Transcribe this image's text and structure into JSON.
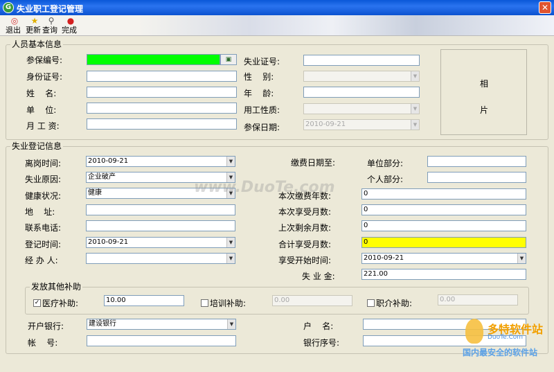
{
  "window": {
    "title": "失业职工登记管理",
    "close_glyph": "✕"
  },
  "toolbar": {
    "exit_label": "退出",
    "update_label": "更新",
    "query_label": "查询",
    "done_label": "完成"
  },
  "basic": {
    "group_title": "人员基本信息",
    "insurance_no_label": "参保编号:",
    "id_no_label": "身份证号:",
    "name_label": "姓    名:",
    "unit_label": "单    位:",
    "salary_label": "月 工 资:",
    "unemp_cert_label": "失业证号:",
    "gender_label": "性    别:",
    "age_label": "年    龄:",
    "employ_nature_label": "用工性质:",
    "insure_date_label": "参保日期:",
    "insure_date_value": "2010-09-21",
    "photo_line1": "相",
    "photo_line2": "片"
  },
  "register": {
    "group_title": "失业登记信息",
    "leave_time_label": "离岗时间:",
    "leave_time_value": "2010-09-21",
    "reason_label": "失业原因:",
    "reason_value": "企业破产",
    "health_label": "健康状况:",
    "health_value": "健康",
    "address_label": "地    址:",
    "phone_label": "联系电话:",
    "reg_time_label": "登记时间:",
    "reg_time_value": "2010-09-21",
    "handler_label": "经 办 人:",
    "pay_until_label": "缴费日期至:",
    "unit_part_label": "单位部分:",
    "personal_part_label": "个人部分:",
    "pay_years_label": "本次缴费年数:",
    "pay_years_value": "0",
    "enjoy_months_label": "本次享受月数:",
    "enjoy_months_value": "0",
    "last_remain_label": "上次剩余月数:",
    "last_remain_value": "0",
    "total_months_label": "合计享受月数:",
    "total_months_value": "0",
    "start_time_label": "享受开始时间:",
    "start_time_value": "2010-09-21",
    "benefit_label": "失 业 金:",
    "benefit_value": "221.00"
  },
  "subsidy": {
    "group_title": "发放其他补助",
    "medical_label": "医疗补助:",
    "medical_value": "10.00",
    "medical_checked": "✓",
    "training_label": "培训补助:",
    "training_value": "0.00",
    "job_label": "职介补助:",
    "job_value": "0.00"
  },
  "bank": {
    "bank_label": "开户银行:",
    "bank_value": "建设银行",
    "account_label": "帐    号:",
    "holder_label": "户    名:",
    "seq_label": "银行序号:"
  },
  "watermarks": {
    "duote": "www.DuoTe.com",
    "logo_cn": "多特软件站",
    "logo_en": "DuoTe.Com",
    "slogan": "国内最安全的软件站"
  }
}
